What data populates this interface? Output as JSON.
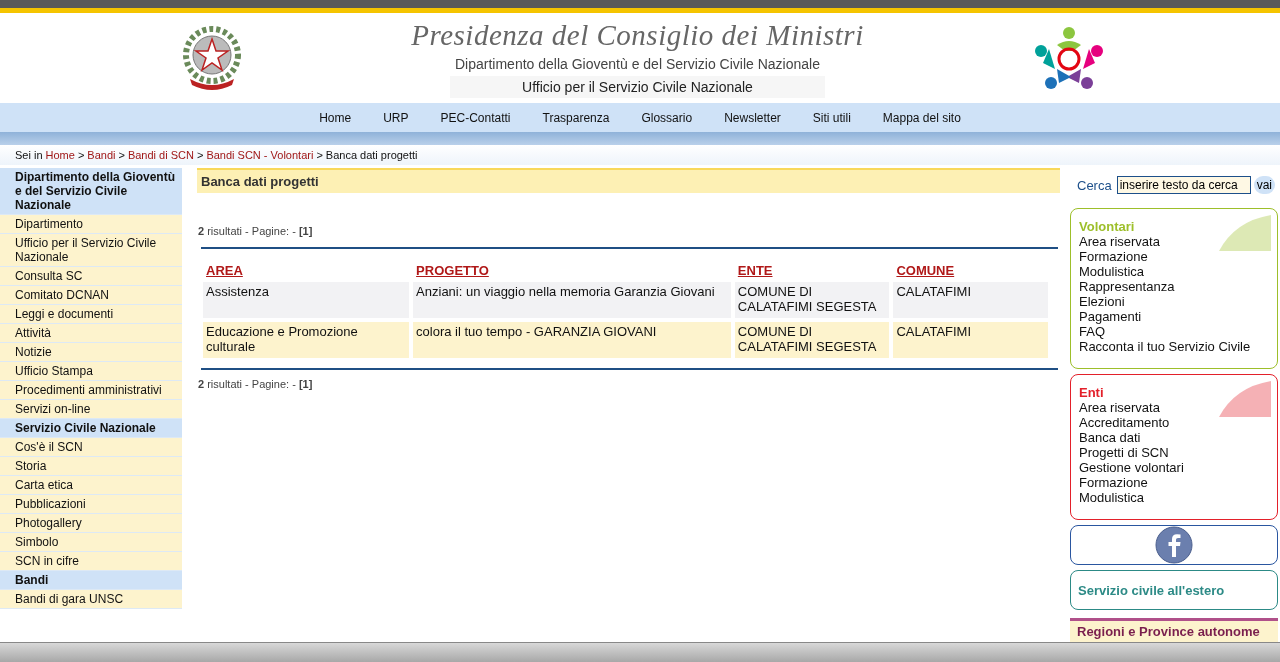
{
  "header": {
    "title": "Presidenza del Consiglio dei Ministri",
    "subtitle": "Dipartimento della Gioventù e del Servizio Civile Nazionale",
    "office": "Ufficio per il Servizio Civile Nazionale"
  },
  "nav": [
    "Home",
    "URP",
    "PEC-Contatti",
    "Trasparenza",
    "Glossario",
    "Newsletter",
    "Siti utili",
    "Mappa del sito"
  ],
  "breadcrumb": {
    "label": "Sei in",
    "links": [
      "Home",
      "Bandi",
      "Bandi di SCN",
      "Bandi SCN - Volontari"
    ],
    "current": "Banca dati progetti",
    "separator": ">"
  },
  "sidebar": [
    {
      "kind": "section",
      "label": "Dipartimento della Gioventù e del Servizio Civile Nazionale"
    },
    {
      "kind": "link",
      "label": "Dipartimento"
    },
    {
      "kind": "link",
      "label": "Ufficio per il Servizio Civile Nazionale"
    },
    {
      "kind": "link",
      "label": "Consulta SC"
    },
    {
      "kind": "link",
      "label": "Comitato DCNAN"
    },
    {
      "kind": "link",
      "label": "Leggi e documenti"
    },
    {
      "kind": "link",
      "label": "Attività"
    },
    {
      "kind": "link",
      "label": "Notizie"
    },
    {
      "kind": "link",
      "label": "Ufficio Stampa"
    },
    {
      "kind": "link",
      "label": "Procedimenti amministrativi"
    },
    {
      "kind": "link",
      "label": "Servizi on-line"
    },
    {
      "kind": "section",
      "label": "Servizio Civile Nazionale"
    },
    {
      "kind": "link",
      "label": "Cos'è il SCN"
    },
    {
      "kind": "link",
      "label": "Storia"
    },
    {
      "kind": "link",
      "label": "Carta etica"
    },
    {
      "kind": "link",
      "label": "Pubblicazioni"
    },
    {
      "kind": "link",
      "label": "Photogallery"
    },
    {
      "kind": "link",
      "label": "Simbolo"
    },
    {
      "kind": "link",
      "label": "SCN in cifre"
    },
    {
      "kind": "section",
      "label": "Bandi"
    },
    {
      "kind": "link",
      "label": "Bandi di gara UNSC"
    }
  ],
  "main": {
    "title": "Banca dati progetti",
    "results_top": "**2** risultati - Pagine: - **[1]**",
    "results_bottom": "**2** risultati - Pagine: - **[1]**",
    "table": {
      "columns": [
        "AREA",
        "PROGETTO",
        "ENTE",
        "COMUNE"
      ],
      "rows": [
        [
          "Assistenza",
          "Anziani: un viaggio nella memoria Garanzia Giovani",
          "COMUNE DI CALATAFIMI SEGESTA",
          "CALATAFIMI"
        ],
        [
          "Educazione e Promozione culturale",
          "colora il tuo tempo - GARANZIA GIOVANI",
          "COMUNE DI CALATAFIMI SEGESTA",
          "CALATAFIMI"
        ]
      ]
    }
  },
  "search": {
    "label": "Cerca",
    "value": "inserire testo da cerca",
    "button": "vai"
  },
  "panels": [
    {
      "title": "Volontari",
      "color": "#9dbf2a",
      "links": [
        "Area riservata",
        "Formazione",
        "Modulistica",
        "Rappresentanza",
        "Elezioni",
        "Pagamenti",
        "FAQ",
        "Racconta il tuo Servizio Civile"
      ]
    },
    {
      "title": "Enti",
      "color": "#e3202a",
      "links": [
        "Area riservata",
        "Accreditamento",
        "Banca dati",
        "Progetti di SCN",
        "Gestione volontari",
        "Formazione",
        "Modulistica"
      ]
    }
  ],
  "abroad": "Servizio civile all'estero",
  "regions": "Regioni e Province autonome"
}
